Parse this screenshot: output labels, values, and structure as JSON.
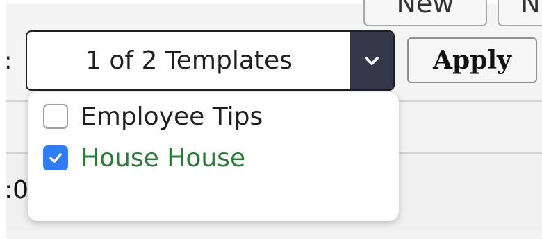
{
  "top_buttons": {
    "new_label": "New",
    "next_label": "N"
  },
  "label_colon": ":",
  "template_select": {
    "value": "1 of 2 Templates"
  },
  "apply_button": {
    "label": "Apply"
  },
  "cut_text": ":0",
  "dropdown": {
    "options": [
      {
        "label": "Employee Tips",
        "checked": false
      },
      {
        "label": "House House",
        "checked": true
      }
    ]
  },
  "colors": {
    "caret_background": "#34394a",
    "checkbox_checked": "#2f7cf6",
    "selected_text": "#2b7a3a",
    "option_text": "#1f1f1f"
  }
}
